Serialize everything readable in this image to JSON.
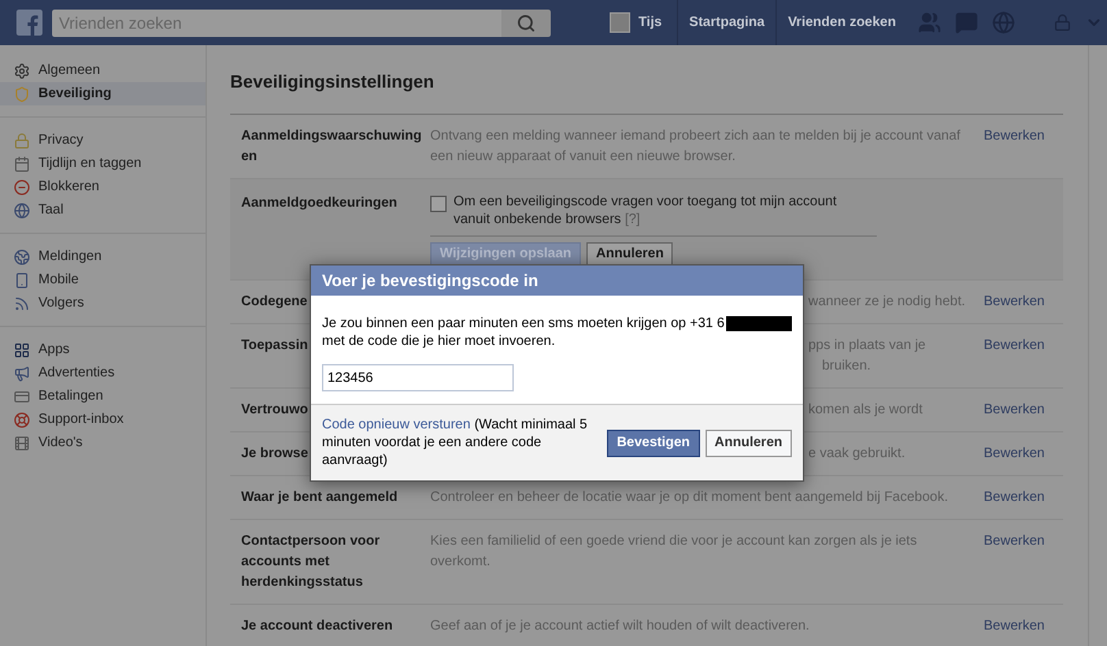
{
  "topbar": {
    "search": {
      "placeholder": "Vrienden zoeken"
    },
    "profile": "Tijs",
    "nav": [
      "Startpagina",
      "Vrienden zoeken"
    ]
  },
  "sidebar": {
    "groups": [
      [
        {
          "label": "Algemeen",
          "selected": false
        },
        {
          "label": "Beveiliging",
          "selected": true
        }
      ],
      [
        {
          "label": "Privacy",
          "selected": false
        },
        {
          "label": "Tijdlijn en taggen",
          "selected": false
        },
        {
          "label": "Blokkeren",
          "selected": false
        },
        {
          "label": "Taal",
          "selected": false
        }
      ],
      [
        {
          "label": "Meldingen",
          "selected": false
        },
        {
          "label": "Mobile",
          "selected": false
        },
        {
          "label": "Volgers",
          "selected": false
        }
      ],
      [
        {
          "label": "Apps",
          "selected": false
        },
        {
          "label": "Advertenties",
          "selected": false
        },
        {
          "label": "Betalingen",
          "selected": false
        },
        {
          "label": "Support-inbox",
          "selected": false
        },
        {
          "label": "Video's",
          "selected": false
        }
      ]
    ]
  },
  "main": {
    "title": "Beveiligingsinstellingen",
    "rows": [
      {
        "kind": "plain",
        "label": "Aanmeldingswaarschuwingen",
        "description": [
          "Ontvang een melding wanneer iemand probeert zich aan te melden bij je account vanaf een nieuw apparaat of vanuit een nieuwe browser."
        ],
        "action": "Bewerken"
      },
      {
        "kind": "expanded",
        "label": "Aanmeldgoedkeuringen",
        "option": {
          "text": "Om een beveiligingscode vragen voor toegang tot mijn account vanuit onbekende browsers",
          "help": "[?]",
          "checked": false
        },
        "buttons": [
          {
            "label": "Wijzigingen opslaan",
            "disabled": true
          },
          {
            "label": "Annuleren",
            "disabled": false
          }
        ]
      },
      {
        "kind": "covered",
        "label": "Codegene",
        "description": [
          "wanneer ze je nodig hebt."
        ],
        "action": "Bewerken"
      },
      {
        "kind": "covered",
        "label": "Toepassin",
        "description": [
          "pps in plaats van je",
          "bruiken."
        ],
        "action": "Bewerken"
      },
      {
        "kind": "covered",
        "label": "Vertrouwo",
        "description": [
          "komen als je wordt"
        ],
        "action": "Bewerken"
      },
      {
        "kind": "covered",
        "label": "Je browse",
        "description": [
          "e vaak gebruikt."
        ],
        "action": "Bewerken"
      },
      {
        "kind": "plain",
        "label": "Waar je bent aangemeld",
        "description": [
          "Controleer en beheer de locatie waar je op dit moment bent aangemeld bij Facebook."
        ],
        "action": "Bewerken"
      },
      {
        "kind": "plain",
        "label": "Contactpersoon voor accounts met herdenkingsstatus",
        "description": [
          "Kies een familielid of een goede vriend die voor je account kan zorgen als je iets overkomt."
        ],
        "action": "Bewerken"
      },
      {
        "kind": "plain",
        "label": "Je account deactiveren",
        "description": [
          "Geef aan of je je account actief wilt houden of wilt deactiveren."
        ],
        "action": "Bewerken"
      }
    ]
  },
  "dialog": {
    "title": "Voer je bevestigingscode in",
    "message": [
      "Je zou binnen een paar minuten een sms moeten krijgen op +31 6",
      "met de code die je hier moet invoeren."
    ],
    "redacted": true,
    "code": "123456",
    "resend_link": "Code opnieuw versturen",
    "note": "(Wacht minimaal 5 minuten voordat je een andere code aanvraagt)",
    "buttons": [
      {
        "label": "Bevestigen",
        "kind": "primary"
      },
      {
        "label": "Annuleren",
        "kind": "secondary"
      }
    ]
  }
}
